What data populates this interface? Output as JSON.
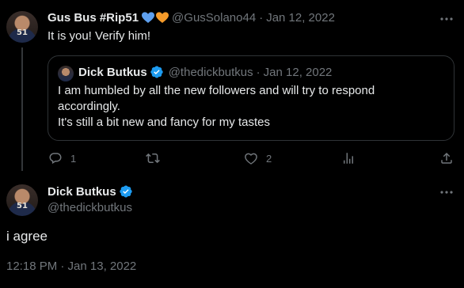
{
  "reply_tweet": {
    "name": "Gus Bus #Rip51",
    "handle": "@GusSolano44",
    "dot": "·",
    "date": "Jan 12, 2022",
    "avatar_number": "51",
    "text": "It is you! Verify him!",
    "heart_colors": [
      "#5ea0ef",
      "#f59b2a"
    ]
  },
  "quoted_tweet": {
    "name": "Dick Butkus",
    "handle": "@thedickbutkus",
    "dot": "·",
    "date": "Jan 12, 2022",
    "text_line1": "I am humbled by all the new followers and will try to respond",
    "text_line2": "accordingly.",
    "text_line3": "It's still a bit new and fancy for my tastes"
  },
  "actions": {
    "reply_count": "1",
    "retweet_count": "",
    "like_count": "2"
  },
  "main_tweet": {
    "name": "Dick Butkus",
    "handle": "@thedickbutkus",
    "avatar_number": "51",
    "text": "i agree",
    "timestamp": "12:18 PM · Jan 13, 2022"
  },
  "colors": {
    "background": "#000000",
    "text": "#e7e9ea",
    "secondary": "#71767b",
    "verified": "#1d9bf0",
    "border": "#2f3336"
  },
  "icons": [
    "more-icon",
    "reply-icon",
    "retweet-icon",
    "like-icon",
    "views-icon",
    "share-icon",
    "verified-icon"
  ]
}
